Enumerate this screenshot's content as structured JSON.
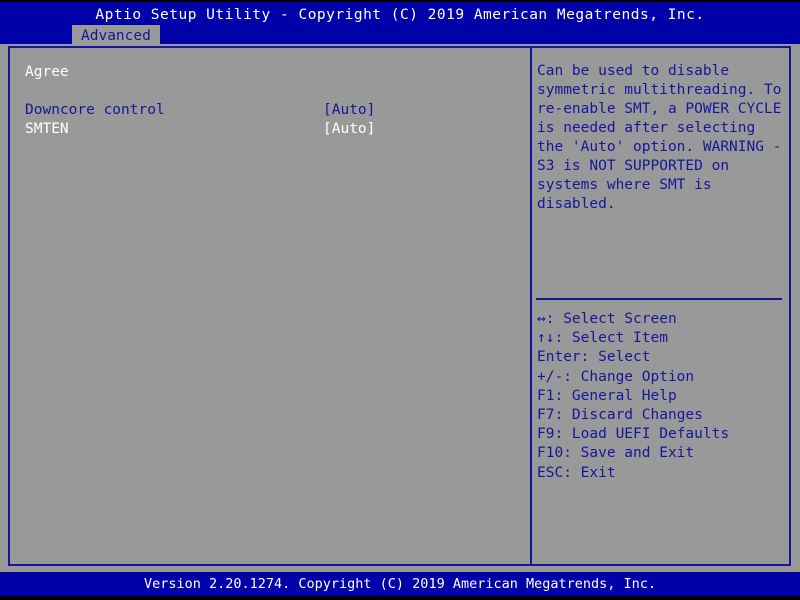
{
  "header": {
    "title": "Aptio Setup Utility - Copyright (C) 2019 American Megatrends, Inc.",
    "active_tab": "Advanced"
  },
  "colors": {
    "header_blue": "#0000a8",
    "body_gray": "#999999",
    "accent_navy": "#16169a",
    "text_white": "#ffffff",
    "tab_gray": "#9a9a9a"
  },
  "main": {
    "section_header": "Agree",
    "options": [
      {
        "label": "Downcore control",
        "value": "[Auto]",
        "selected": true
      },
      {
        "label": "SMTEN",
        "value": "[Auto]",
        "selected": false
      }
    ]
  },
  "help": {
    "text": "Can be used to disable symmetric multithreading. To re-enable SMT, a POWER CYCLE is needed after selecting the 'Auto' option. WARNING - S3 is NOT SUPPORTED on systems where SMT is disabled."
  },
  "keys": [
    {
      "key": "↔:",
      "action": "Select Screen"
    },
    {
      "key": "↑↓:",
      "action": "Select Item"
    },
    {
      "key": "Enter:",
      "action": "Select"
    },
    {
      "key": "+/-:",
      "action": "Change Option"
    },
    {
      "key": "F1:",
      "action": "General Help"
    },
    {
      "key": "F7:",
      "action": "Discard Changes"
    },
    {
      "key": "F9:",
      "action": "Load UEFI Defaults"
    },
    {
      "key": "F10:",
      "action": "Save and Exit"
    },
    {
      "key": "ESC:",
      "action": "Exit"
    }
  ],
  "footer": {
    "version": "Version 2.20.1274. Copyright (C) 2019 American Megatrends, Inc."
  }
}
